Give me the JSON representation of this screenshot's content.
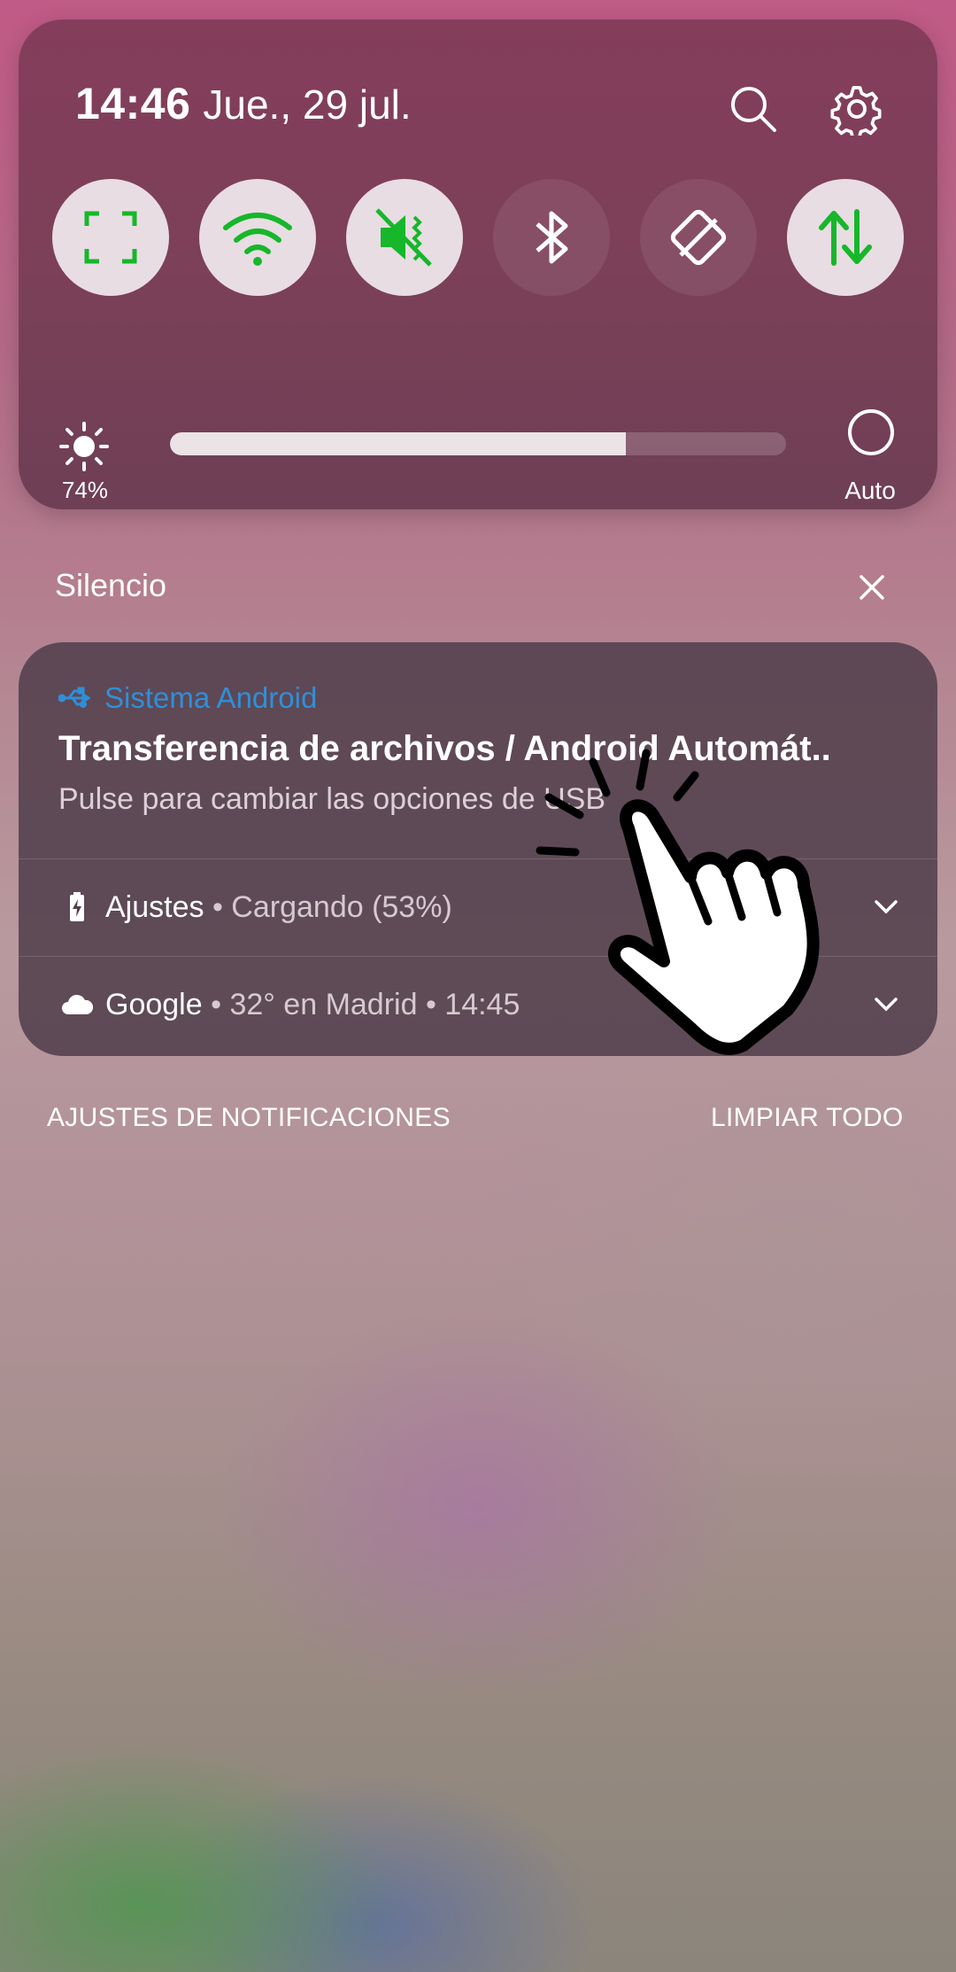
{
  "quick_settings": {
    "time": "14:46",
    "date": "Jue., 29 jul.",
    "search_icon": "search-icon",
    "settings_icon": "gear-icon",
    "tiles": [
      {
        "name": "screenshot-capture-icon",
        "state": "on"
      },
      {
        "name": "wifi-icon",
        "state": "on"
      },
      {
        "name": "vibrate-mute-icon",
        "state": "on"
      },
      {
        "name": "bluetooth-icon",
        "state": "off"
      },
      {
        "name": "auto-rotate-icon",
        "state": "off"
      },
      {
        "name": "mobile-data-icon",
        "state": "on"
      }
    ],
    "brightness": {
      "percent_label": "74%",
      "level": 0.74,
      "auto_label": "Auto"
    }
  },
  "silent_section": {
    "label": "Silencio"
  },
  "notification": {
    "app_name": "Sistema Android",
    "title": "Transferencia de archivos / Android Automát..",
    "text": "Pulse para cambiar las opciones de USB"
  },
  "rows": [
    {
      "app": "Ajustes",
      "detail": "• Cargando (53%)",
      "icon": "battery-charging-icon"
    },
    {
      "app": "Google",
      "detail": "• 32° en Madrid • 14:45",
      "icon": "cloud-icon"
    }
  ],
  "footer": {
    "settings_label": "AJUSTES DE NOTIFICACIONES",
    "clear_label": "LIMPIAR TODO"
  },
  "colors": {
    "accent_green": "#16b72a",
    "app_blue": "#2f8fd9"
  }
}
